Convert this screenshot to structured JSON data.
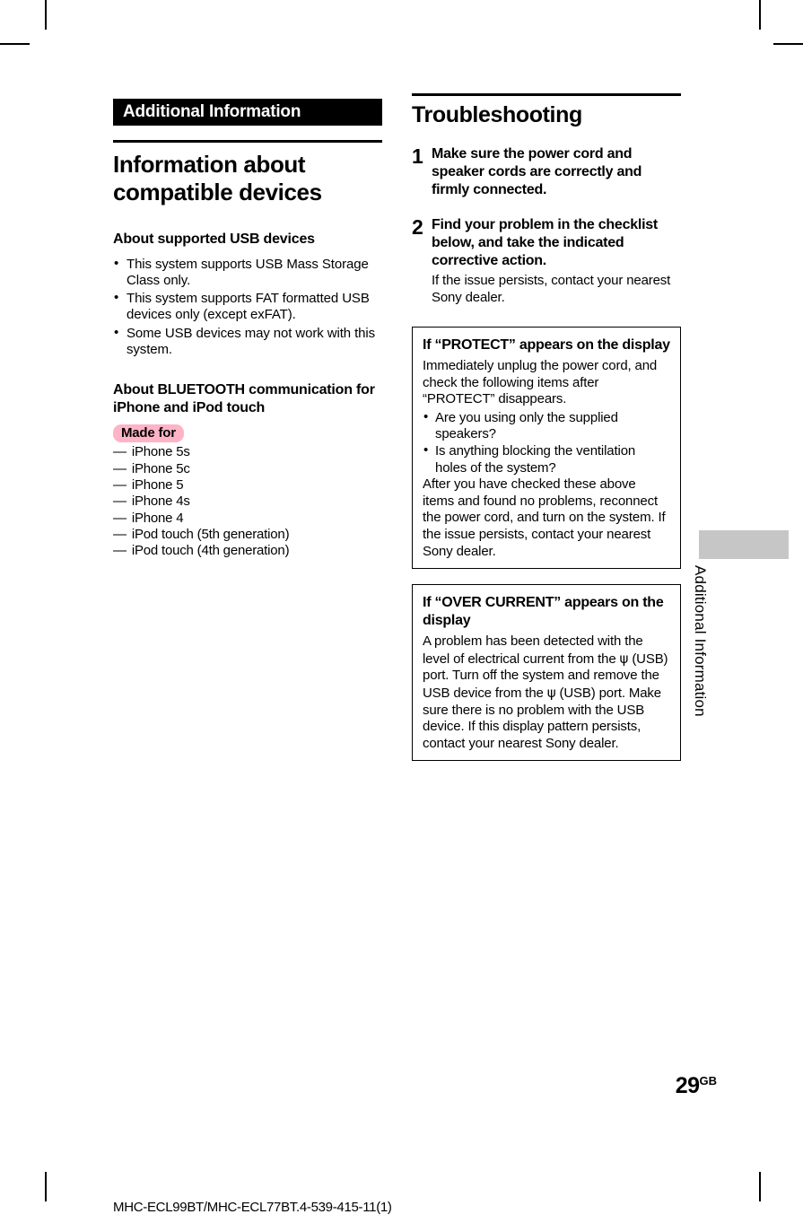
{
  "document": {
    "footer_code": "MHC-ECL99BT/MHC-ECL77BT.4-539-415-11(1)",
    "page_number": "29",
    "page_suffix": "GB",
    "side_tab_label": "Additional Information",
    "badge_color": "#ffb3c7",
    "tab_block_color": "#c6c6c6"
  },
  "left_column": {
    "section_banner": "Additional Information",
    "heading": "Information about compatible devices",
    "usb_section": {
      "heading": "About supported USB devices",
      "bullets": [
        "This system supports USB Mass Storage Class only.",
        "This system supports FAT formatted USB devices only (except exFAT).",
        "Some USB devices may not work with this system."
      ]
    },
    "bluetooth_section": {
      "heading": "About BLUETOOTH communication for iPhone and iPod touch",
      "badge": "Made for",
      "dash": "—",
      "devices": [
        "iPhone 5s",
        "iPhone 5c",
        "iPhone 5",
        "iPhone 4s",
        "iPhone 4",
        "iPod touch (5th generation)",
        "iPod touch (4th generation)"
      ]
    }
  },
  "right_column": {
    "heading": "Troubleshooting",
    "steps": [
      {
        "number": "1",
        "title": "Make sure the power cord and speaker cords are correctly and firmly connected.",
        "sub": ""
      },
      {
        "number": "2",
        "title": "Find your problem in the checklist below, and take the indicated corrective action.",
        "sub": "If the issue persists, contact your nearest Sony dealer."
      }
    ],
    "boxes": [
      {
        "title": "If “PROTECT” appears on the display",
        "paragraph1": "Immediately unplug the power cord, and check the following items after “PROTECT” disappears.",
        "bullets": [
          "Are you using only the supplied speakers?",
          "Is anything blocking the ventilation holes of the system?"
        ],
        "paragraph2": "After you have checked these above items and found no problems, reconnect the power cord, and turn on the system. If the issue persists, contact your nearest Sony dealer."
      },
      {
        "title": "If “OVER CURRENT” appears on the display",
        "usb_icon": "ψ",
        "paragraph_part1": "A problem has been detected with the level of electrical current from the ",
        "paragraph_part2": " (USB) port. Turn off the system and remove the USB device from the ",
        "paragraph_part3": " (USB) port. Make sure there is no problem with the USB device. If this display pattern persists, contact your nearest Sony dealer."
      }
    ]
  }
}
